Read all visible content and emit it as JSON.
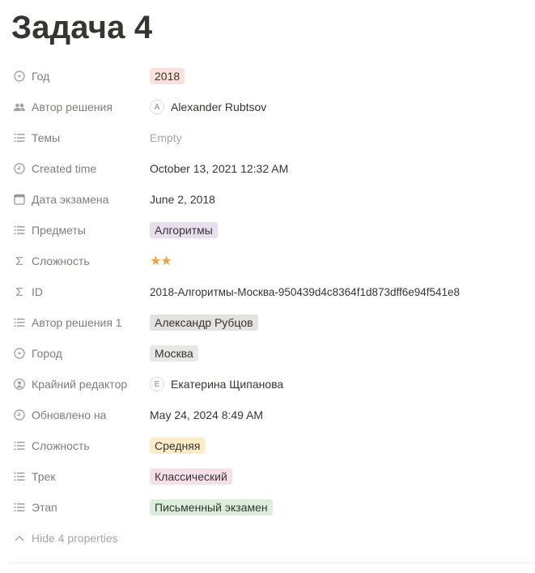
{
  "page": {
    "title": "Задача 4"
  },
  "colors": {
    "tag_red": "#fde0dc",
    "tag_purple": "#e8deee",
    "tag_gray": "#e3e2e0",
    "tag_orange": "#fadec9",
    "tag_yellow": "#fdecc8",
    "tag_pink": "#f5e0e9",
    "tag_green": "#dbeddb",
    "stars": "#f2a23c"
  },
  "properties": [
    {
      "icon": "select-icon",
      "label": "Год",
      "value": "2018"
    },
    {
      "icon": "people-icon",
      "label": "Автор решения",
      "avatar": "A",
      "value": "Alexander Rubtsov"
    },
    {
      "icon": "list-icon",
      "label": "Темы",
      "value": "Empty"
    },
    {
      "icon": "clock-icon",
      "label": "Created time",
      "value": "October 13, 2021 12:32 AM"
    },
    {
      "icon": "calendar-icon",
      "label": "Дата экзамена",
      "value": "June 2, 2018"
    },
    {
      "icon": "list-icon",
      "label": "Предметы",
      "value": "Алгоритмы"
    },
    {
      "icon": "sigma-icon",
      "label": "Сложность",
      "value": "★★"
    },
    {
      "icon": "sigma-icon",
      "label": "ID",
      "value": "2018-Алгоритмы-Москва-950439d4c8364f1d873dff6e94f541e8"
    },
    {
      "icon": "list-icon",
      "label": "Автор решения 1",
      "value": "Александр Рубцов"
    },
    {
      "icon": "select-icon",
      "label": "Город",
      "value": "Москва"
    },
    {
      "icon": "person-circle-icon",
      "label": "Крайний редактор",
      "avatar": "E",
      "value": "Екатерина Щипанова"
    },
    {
      "icon": "clock-icon",
      "label": "Обновлено на",
      "value": "May 24, 2024 8:49 AM"
    },
    {
      "icon": "list-icon",
      "label": "Сложность",
      "value": "Средняя"
    },
    {
      "icon": "list-icon",
      "label": "Трек",
      "value": "Классический"
    },
    {
      "icon": "list-icon",
      "label": "Этап",
      "value": "Письменный экзамен"
    }
  ],
  "hide_properties": {
    "label": "Hide 4 properties"
  }
}
